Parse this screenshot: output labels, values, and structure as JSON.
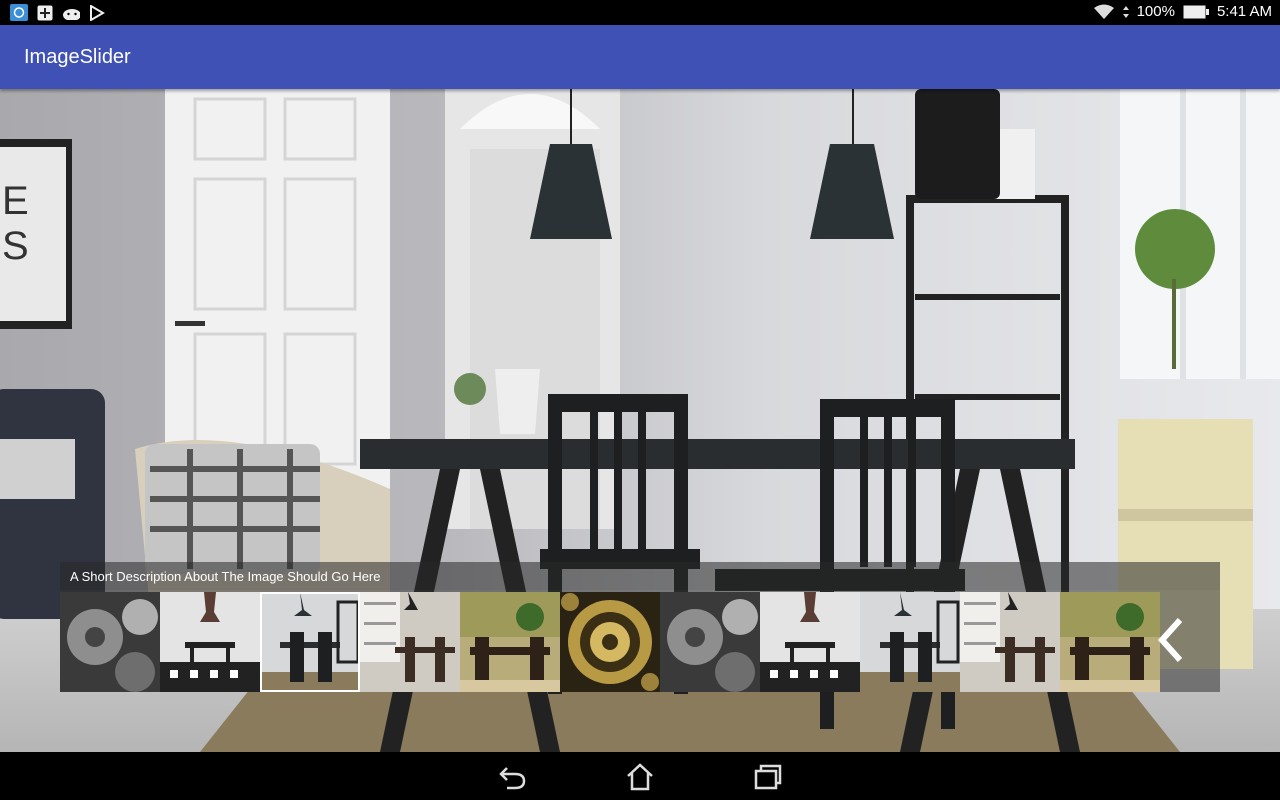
{
  "status_bar": {
    "icons": [
      "app-notification-icon",
      "add-box-icon",
      "android-icon",
      "play-store-icon"
    ],
    "battery": "100%",
    "time": "5:41 AM"
  },
  "app_bar": {
    "title": "ImageSlider"
  },
  "slider": {
    "caption": "A Short Description About The Image Should Go Here",
    "selected_thumbnail": 2,
    "thumbnails": [
      {
        "kind": "gears"
      },
      {
        "kind": "dining-pendant"
      },
      {
        "kind": "dining-white"
      },
      {
        "kind": "dining-shelves"
      },
      {
        "kind": "dining-green"
      },
      {
        "kind": "gold-gear"
      },
      {
        "kind": "gears"
      },
      {
        "kind": "dining-pendant"
      },
      {
        "kind": "dining-white"
      },
      {
        "kind": "dining-shelves"
      },
      {
        "kind": "dining-green"
      }
    ],
    "prev_icon": "chevron-left-icon"
  },
  "nav_bar": {
    "icons": [
      "back-icon",
      "home-icon",
      "recents-icon"
    ]
  }
}
